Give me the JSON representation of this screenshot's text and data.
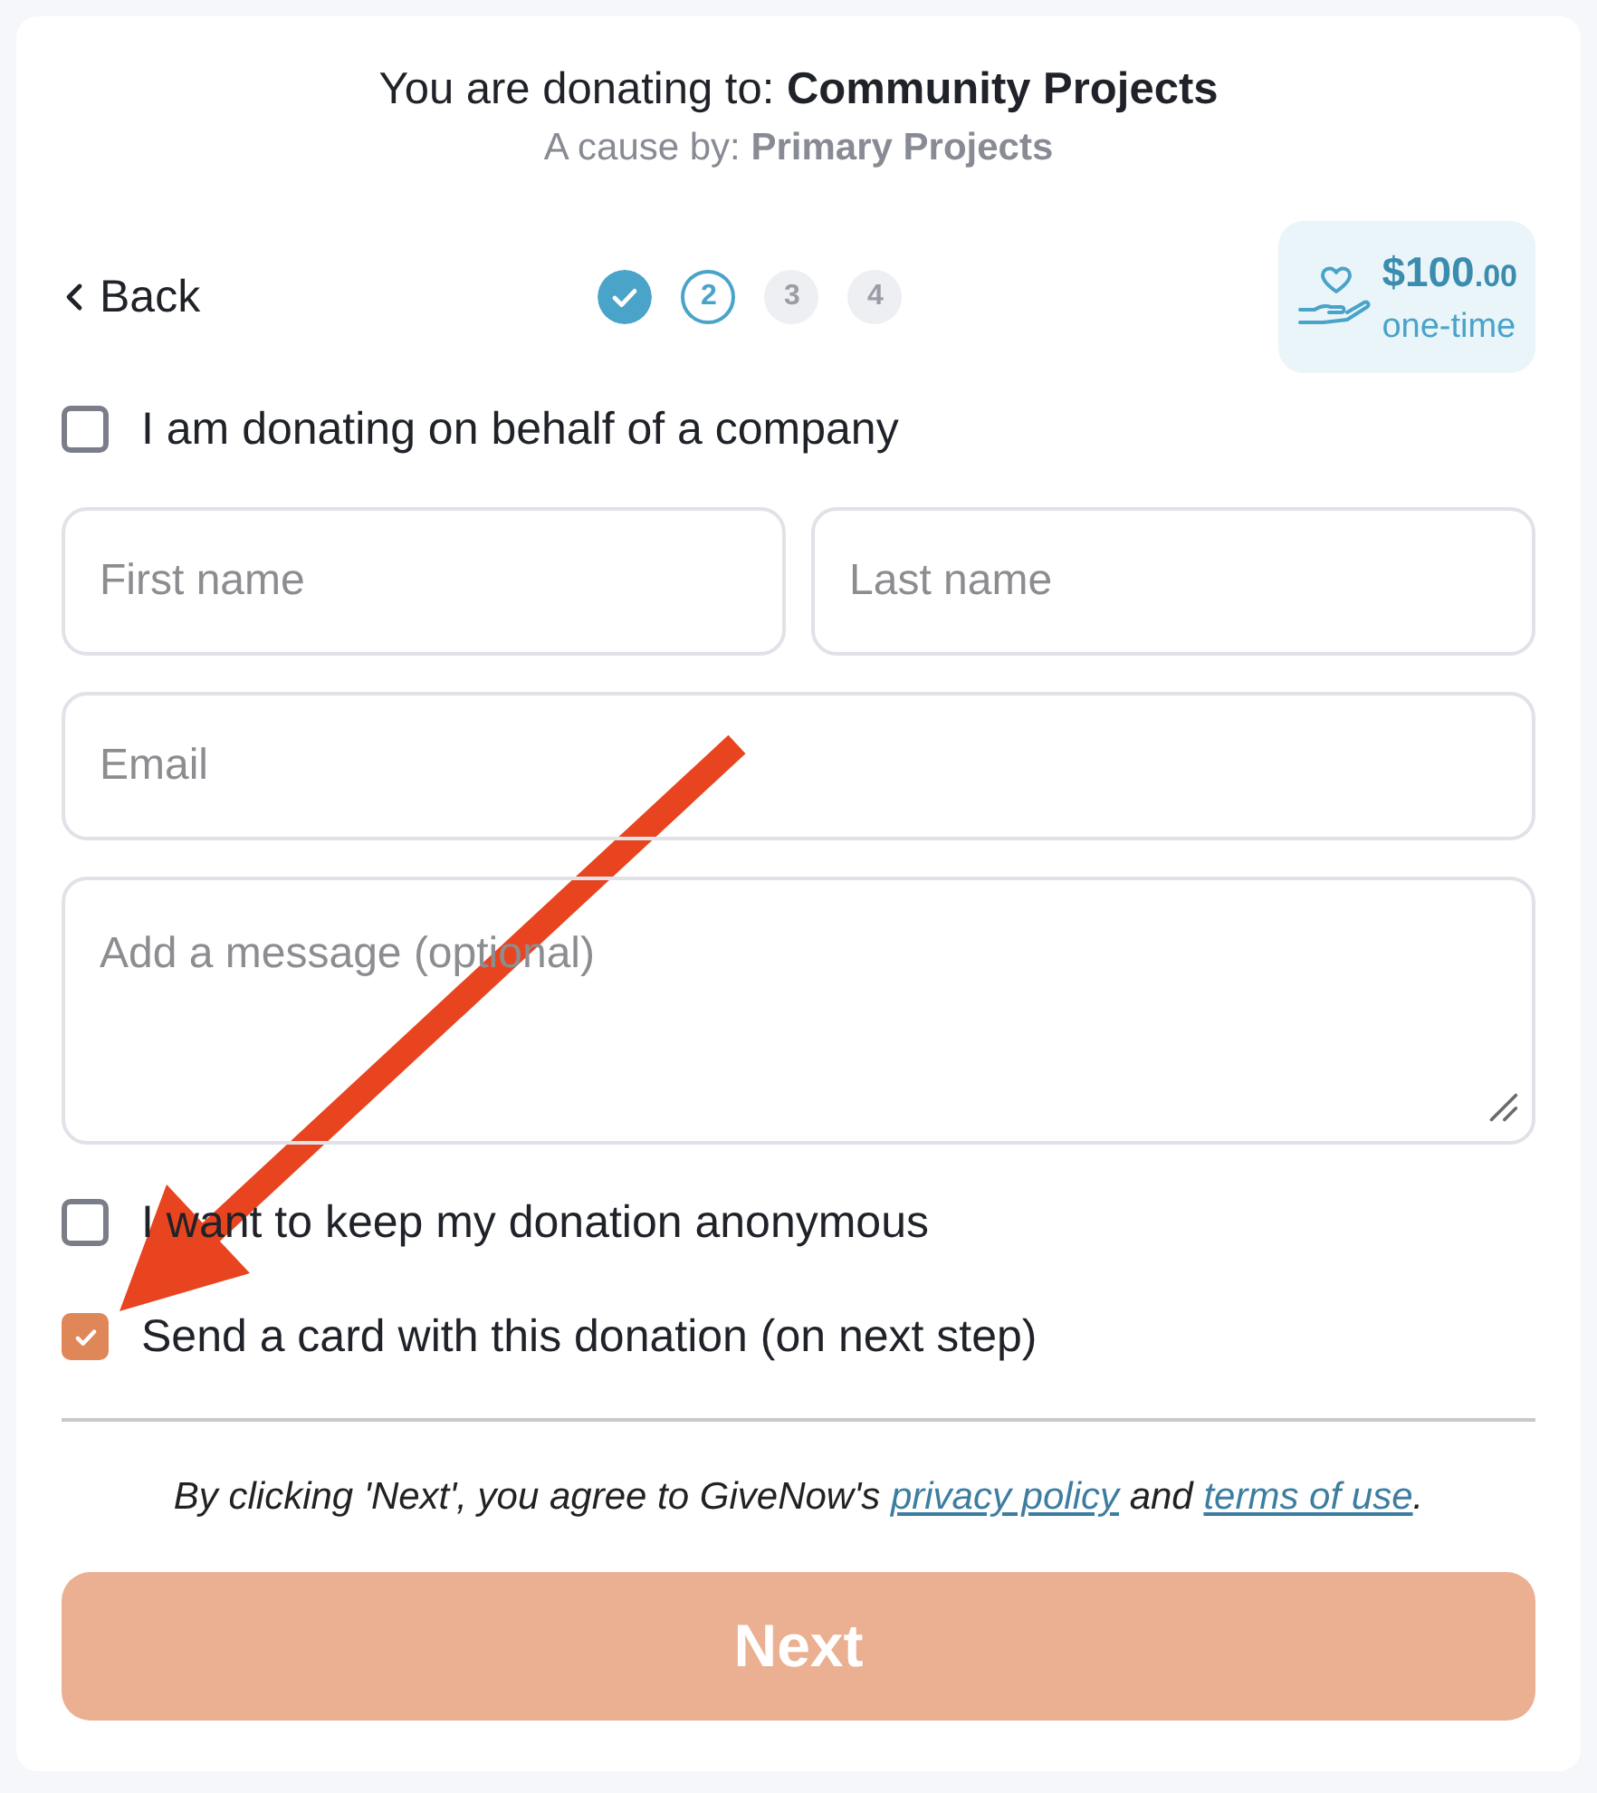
{
  "header": {
    "title": "You are donating to: **Community Projects**",
    "subtitle": "A cause by: **Primary Projects**"
  },
  "nav": {
    "back_label": "Back",
    "steps": [
      {
        "completed": true,
        "selected": false
      },
      {
        "label": "2",
        "completed": false,
        "selected": true
      },
      {
        "label": "3",
        "completed": false,
        "selected": false
      },
      {
        "label": "4",
        "completed": false,
        "selected": false
      }
    ]
  },
  "amount": {
    "value": "$100",
    "cents": ".00",
    "frequency": "one-time"
  },
  "company_option": {
    "label": "I am donating on behalf of a company",
    "checked": false
  },
  "field_rows": [
    [
      {
        "kind": "input",
        "placeholder": "First name"
      },
      {
        "kind": "input",
        "placeholder": "Last name"
      }
    ],
    [
      {
        "kind": "input",
        "placeholder": "Email"
      }
    ],
    [
      {
        "kind": "textarea",
        "placeholder": "Add a message (optional)"
      }
    ]
  ],
  "options": [
    {
      "label": "I want to keep my donation anonymous",
      "checked": false
    },
    {
      "label": "Send a card with this donation (on next step)",
      "checked": true
    }
  ],
  "terms": [
    {
      "kind": "text",
      "text": "By clicking 'Next', you agree to GiveNow's "
    },
    {
      "kind": "link",
      "text": "privacy policy"
    },
    {
      "kind": "text",
      "text": " and "
    },
    {
      "kind": "link",
      "text": "terms of use"
    },
    {
      "kind": "text",
      "text": "."
    }
  ],
  "next_button": {
    "label": "Next",
    "disabled": true
  }
}
